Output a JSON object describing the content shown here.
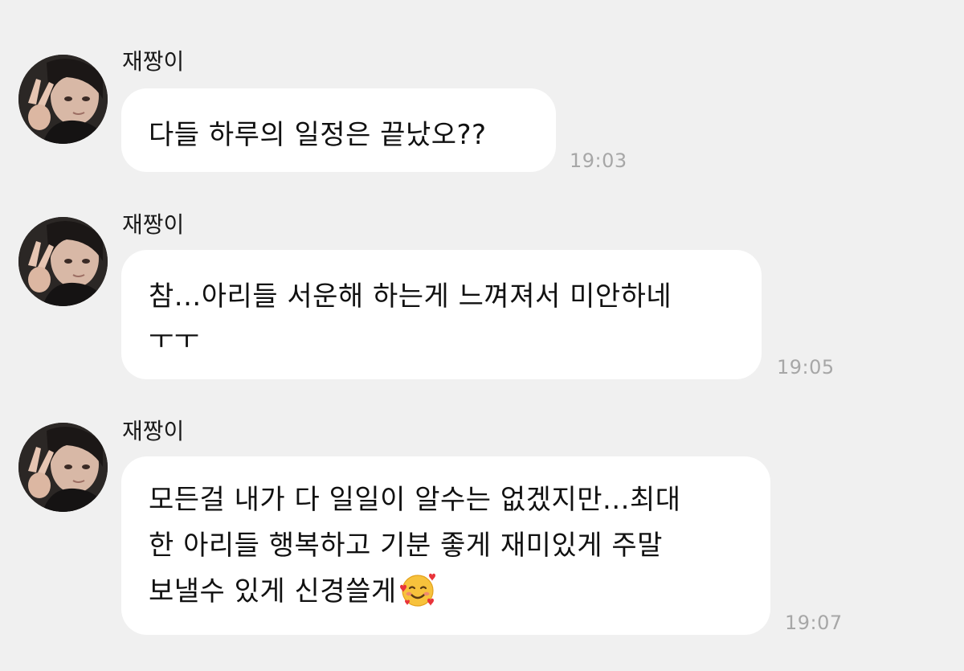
{
  "messages": [
    {
      "sender": "재짱이",
      "lines": [
        "다들 하루의 일정은 끝났오??"
      ],
      "time": "19:03"
    },
    {
      "sender": "재짱이",
      "lines": [
        "참...아리들 서운해 하는게 느껴져서 미안하네",
        "ㅜㅜ"
      ],
      "time": "19:05"
    },
    {
      "sender": "재짱이",
      "lines": [
        "모든걸 내가 다 일일이 알수는 없겠지만...최대",
        "한 아리들 행복하고 기분 좋게 재미있게 주말",
        "보낼수 있게 신경쓸게"
      ],
      "emoji": "smiling-face-with-hearts-icon",
      "time": "19:07"
    }
  ],
  "colors": {
    "background": "#f0f0f0",
    "bubble": "#ffffff",
    "timestamp": "#a7a7a7",
    "text": "#111111"
  }
}
